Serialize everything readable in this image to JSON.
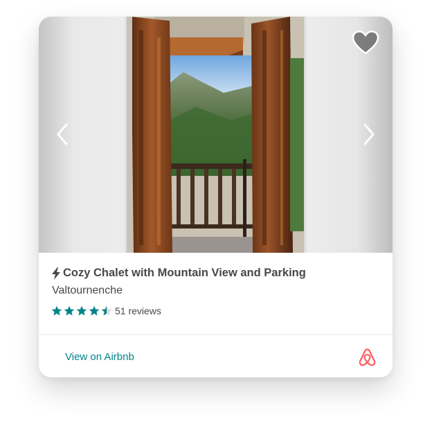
{
  "listing": {
    "title": "Cozy Chalet with Mountain View and Parking",
    "location": "Valtournenche",
    "rating": 4.5,
    "rating_max": 5,
    "reviews_label": "51 reviews"
  },
  "footer": {
    "link_label": "View on Airbnb"
  },
  "icons": {
    "title_prefix": "lightning-bolt-icon",
    "prev": "chevron-left-icon",
    "next": "chevron-right-icon",
    "favorite": "heart-icon",
    "brand": "airbnb-logo-icon"
  },
  "colors": {
    "accent_teal": "#008489",
    "brand_red": "#FF5A5F",
    "text_dark": "#484848"
  }
}
